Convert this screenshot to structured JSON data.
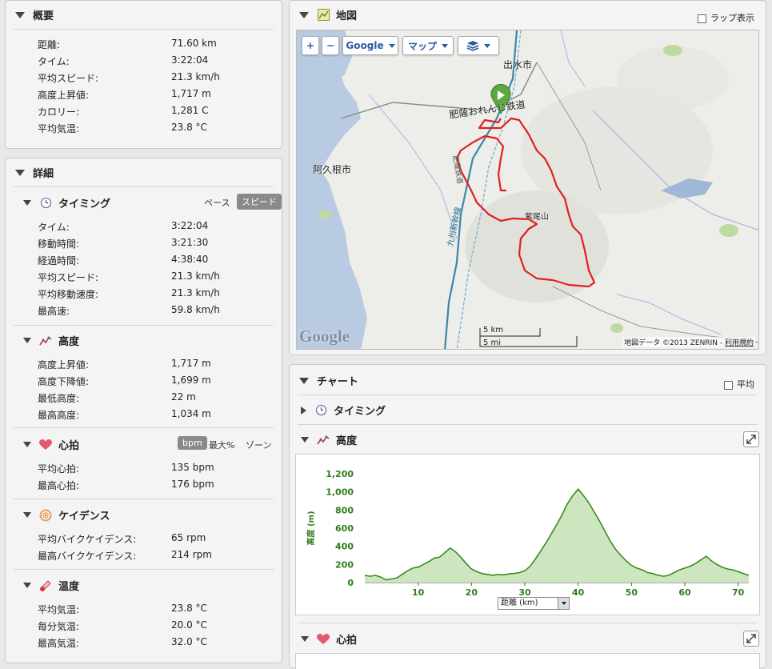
{
  "summary": {
    "title": "概要",
    "rows": [
      {
        "label": "距離:",
        "value": "71.60 km"
      },
      {
        "label": "タイム:",
        "value": "3:22:04"
      },
      {
        "label": "平均スピード:",
        "value": "21.3 km/h"
      },
      {
        "label": "高度上昇値:",
        "value": "1,717 m"
      },
      {
        "label": "カロリー:",
        "value": "1,281 C"
      },
      {
        "label": "平均気温:",
        "value": "23.8 °C"
      }
    ]
  },
  "details": {
    "title": "詳細",
    "timing": {
      "title": "タイミング",
      "toggle_pace": "ペース",
      "toggle_speed": "スピード",
      "rows": [
        {
          "label": "タイム:",
          "value": "3:22:04"
        },
        {
          "label": "移動時間:",
          "value": "3:21:30"
        },
        {
          "label": "経過時間:",
          "value": "4:38:40"
        },
        {
          "label": "平均スピード:",
          "value": "21.3 km/h"
        },
        {
          "label": "平均移動速度:",
          "value": "21.3 km/h"
        },
        {
          "label": "最高速:",
          "value": "59.8 km/h"
        }
      ]
    },
    "elevation": {
      "title": "高度",
      "rows": [
        {
          "label": "高度上昇値:",
          "value": "1,717 m"
        },
        {
          "label": "高度下降値:",
          "value": "1,699 m"
        },
        {
          "label": "最低高度:",
          "value": "22 m"
        },
        {
          "label": "最高高度:",
          "value": "1,034 m"
        }
      ]
    },
    "heart": {
      "title": "心拍",
      "toggle_bpm": "bpm",
      "toggle_max": "最大%",
      "toggle_zone": "ゾーン",
      "rows": [
        {
          "label": "平均心拍:",
          "value": "135 bpm"
        },
        {
          "label": "最高心拍:",
          "value": "176 bpm"
        }
      ]
    },
    "cadence": {
      "title": "ケイデンス",
      "rows": [
        {
          "label": "平均バイクケイデンス:",
          "value": "65 rpm"
        },
        {
          "label": "最高バイクケイデンス:",
          "value": "214 rpm"
        }
      ]
    },
    "temperature": {
      "title": "温度",
      "rows": [
        {
          "label": "平均気温:",
          "value": "23.8 °C"
        },
        {
          "label": "毎分気温:",
          "value": "20.0 °C"
        },
        {
          "label": "最高気温:",
          "value": "32.0 °C"
        }
      ]
    }
  },
  "map": {
    "title": "地図",
    "lap_label": "ラップ表示",
    "zoom_in": "+",
    "zoom_out": "−",
    "provider": "Google",
    "map_type": "マップ",
    "place_izumi": "出水市",
    "place_akune": "阿久根市",
    "place_road": "肥薩おれんじ鉄道",
    "place_mountain": "紫尾山",
    "rail_label": "九州新幹線",
    "road_label": "肥薩鉄道",
    "scale_km": "5 km",
    "scale_mi": "5 mi",
    "logo": "Google",
    "attribution": "地図データ ©2013 ZENRIN -",
    "terms": "利用規約"
  },
  "chart_panel": {
    "title": "チャート",
    "avg_label": "平均",
    "timing_label": "タイミング",
    "elevation_label": "高度",
    "heart_label": "心拍",
    "x_select": "距離 (km)"
  },
  "chart_data": {
    "type": "area",
    "ylabel": "高度 (m)",
    "xlabel": "距離 (km)",
    "xlim": [
      0,
      72
    ],
    "ylim": [
      0,
      1200
    ],
    "x_ticks": [
      10,
      20,
      30,
      40,
      50,
      60,
      70
    ],
    "y_ticks": [
      0,
      200,
      400,
      600,
      800,
      1000,
      1200
    ],
    "y_tick_labels": [
      "0",
      "200",
      "400",
      "600",
      "800",
      "1,000",
      "1,200"
    ],
    "color": "#3a8a1f",
    "fill": "#cde6c0",
    "x": [
      0,
      1,
      2,
      3,
      4,
      5,
      6,
      7,
      8,
      9,
      10,
      11,
      12,
      13,
      14,
      15,
      16,
      17,
      18,
      19,
      20,
      21,
      22,
      23,
      24,
      25,
      26,
      27,
      28,
      29,
      30,
      31,
      32,
      33,
      34,
      35,
      36,
      37,
      38,
      39,
      40,
      41,
      42,
      43,
      44,
      45,
      46,
      47,
      48,
      49,
      50,
      51,
      52,
      53,
      54,
      55,
      56,
      57,
      58,
      59,
      60,
      61,
      62,
      63,
      64,
      65,
      66,
      67,
      68,
      69,
      70,
      71,
      72
    ],
    "y": [
      80,
      70,
      80,
      60,
      30,
      40,
      50,
      90,
      130,
      160,
      170,
      200,
      230,
      270,
      280,
      330,
      380,
      340,
      280,
      210,
      150,
      120,
      100,
      90,
      80,
      90,
      85,
      95,
      100,
      110,
      130,
      180,
      260,
      350,
      440,
      540,
      640,
      750,
      870,
      960,
      1030,
      960,
      880,
      780,
      680,
      570,
      460,
      370,
      300,
      240,
      190,
      160,
      140,
      110,
      100,
      80,
      70,
      80,
      110,
      140,
      160,
      180,
      210,
      250,
      290,
      240,
      200,
      170,
      150,
      140,
      120,
      100,
      80
    ]
  }
}
